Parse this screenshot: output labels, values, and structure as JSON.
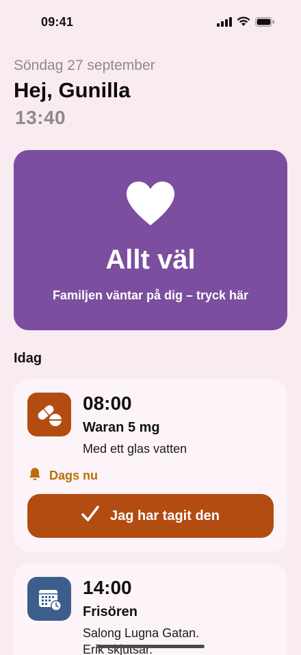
{
  "status_bar": {
    "time": "09:41"
  },
  "header": {
    "date": "Söndag 27 september",
    "greeting": "Hej, Gunilla",
    "clock": "13:40"
  },
  "hero": {
    "icon": "heart-icon",
    "title": "Allt väl",
    "subtitle": "Familjen väntar på dig – tryck här",
    "color": "#7b4e9f"
  },
  "section": {
    "title": "Idag"
  },
  "tasks": [
    {
      "time": "08:00",
      "name": "Waran 5 mg",
      "note": "Med ett glas vatten",
      "icon": "pill-icon",
      "icon_color": "#b24c11",
      "status": "Dags nu",
      "status_icon": "bell-icon",
      "action_label": "Jag har tagit den"
    },
    {
      "time": "14:00",
      "name": "Frisören",
      "note_line1": "Salong Lugna Gatan.",
      "note_line2": "Erik skjutsar.",
      "icon": "calendar-clock-icon",
      "icon_color": "#3d5e8c"
    }
  ]
}
